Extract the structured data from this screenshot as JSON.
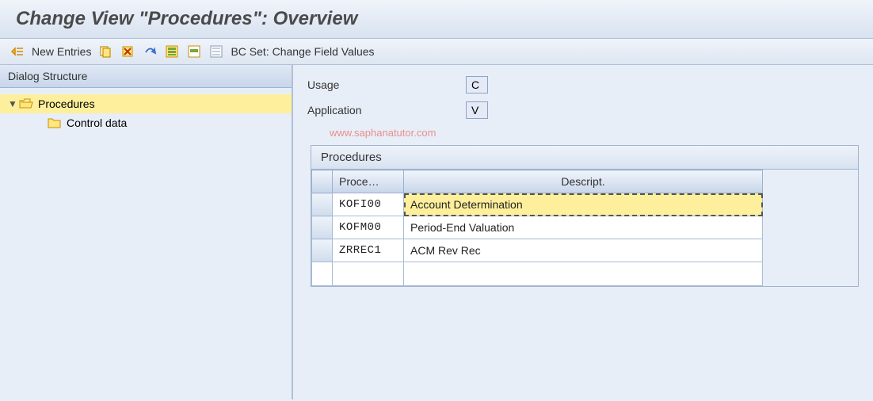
{
  "title": "Change View \"Procedures\": Overview",
  "toolbar": {
    "new_entries": "New Entries",
    "bc_set": "BC Set: Change Field Values"
  },
  "sidebar": {
    "header": "Dialog Structure",
    "items": [
      {
        "label": "Procedures"
      },
      {
        "label": "Control data"
      }
    ]
  },
  "fields": {
    "usage_label": "Usage",
    "usage_value": "C",
    "application_label": "Application",
    "application_value": "V"
  },
  "watermark": "www.saphanatutor.com",
  "table": {
    "title": "Procedures",
    "col_proc": "Proce…",
    "col_desc": "Descript.",
    "rows": [
      {
        "proc": "KOFI00",
        "desc": "Account Determination",
        "hl": true
      },
      {
        "proc": "KOFM00",
        "desc": "Period-End Valuation",
        "hl": false
      },
      {
        "proc": "ZRREC1",
        "desc": "ACM Rev Rec",
        "hl": false
      }
    ]
  }
}
